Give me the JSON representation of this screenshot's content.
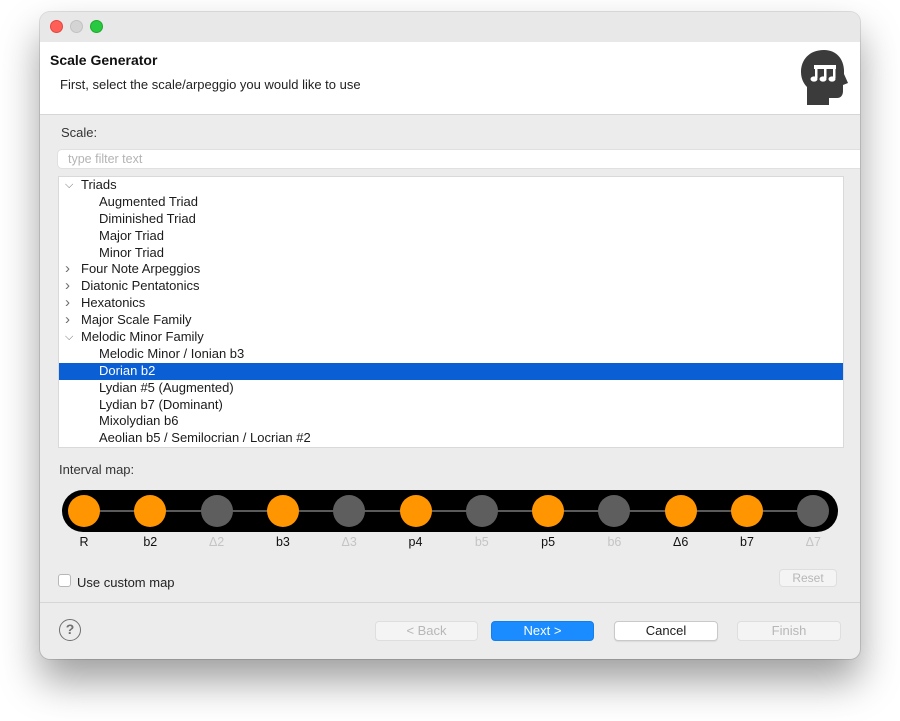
{
  "wizard": {
    "title": "Scale Generator",
    "subtitle": "First, select the scale/arpeggio you would like to use",
    "icon": "head-music-icon"
  },
  "scale": {
    "label": "Scale:",
    "filter_placeholder": "type filter text",
    "filter_value": "",
    "tree": [
      {
        "kind": "parent",
        "label": "Triads",
        "expanded": true
      },
      {
        "kind": "child",
        "label": "Augmented Triad"
      },
      {
        "kind": "child",
        "label": "Diminished Triad"
      },
      {
        "kind": "child",
        "label": "Major Triad"
      },
      {
        "kind": "child",
        "label": "Minor Triad"
      },
      {
        "kind": "parent",
        "label": "Four Note Arpeggios",
        "expanded": false
      },
      {
        "kind": "parent",
        "label": "Diatonic Pentatonics",
        "expanded": false
      },
      {
        "kind": "parent",
        "label": "Hexatonics",
        "expanded": false
      },
      {
        "kind": "parent",
        "label": "Major Scale Family",
        "expanded": false
      },
      {
        "kind": "parent",
        "label": "Melodic Minor Family",
        "expanded": true
      },
      {
        "kind": "child",
        "label": "Melodic Minor / Ionian b3"
      },
      {
        "kind": "child",
        "label": "Dorian b2",
        "selected": true
      },
      {
        "kind": "child",
        "label": "Lydian #5 (Augmented)"
      },
      {
        "kind": "child",
        "label": "Lydian b7 (Dominant)"
      },
      {
        "kind": "child",
        "label": "Mixolydian b6"
      },
      {
        "kind": "child",
        "label": "Aeolian b5 / Semilocrian / Locrian #2"
      }
    ]
  },
  "interval_map": {
    "label": "Interval map:",
    "intervals": [
      {
        "label": "R",
        "active": true
      },
      {
        "label": "b2",
        "active": true
      },
      {
        "label": "Δ2",
        "active": false
      },
      {
        "label": "b3",
        "active": true
      },
      {
        "label": "Δ3",
        "active": false
      },
      {
        "label": "p4",
        "active": true
      },
      {
        "label": "b5",
        "active": false
      },
      {
        "label": "p5",
        "active": true
      },
      {
        "label": "b6",
        "active": false
      },
      {
        "label": "Δ6",
        "active": true
      },
      {
        "label": "b7",
        "active": true
      },
      {
        "label": "Δ7",
        "active": false
      }
    ],
    "active_color": "#ff9500",
    "inactive_color": "#5e5e5e"
  },
  "custom_map": {
    "label": "Use custom map",
    "checked": false
  },
  "buttons": {
    "reset": "Reset",
    "back": "< Back",
    "next": "Next >",
    "cancel": "Cancel",
    "finish": "Finish"
  },
  "help": {
    "icon": "help-icon",
    "glyph": "?"
  },
  "colors": {
    "selection": "#0a5fd4",
    "primary_button": "#1a8cff"
  }
}
